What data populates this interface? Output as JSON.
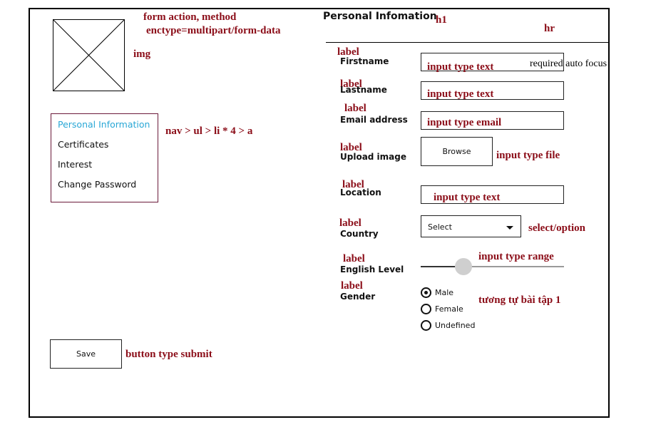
{
  "annotations": {
    "form_line1": "form action, method",
    "form_line2": "enctype=multipart/form-data",
    "img": "img",
    "nav": "nav > ul > li * 4 > a",
    "h1": "h1",
    "hr": "hr",
    "button": "button type submit",
    "required": "required auto focus",
    "label": "label",
    "input_text": "input type text",
    "input_email": "input type email",
    "input_file": "input type file",
    "select": "select/option",
    "range": "input type range",
    "radio": "tương tự bài tập 1"
  },
  "nav": {
    "items": [
      {
        "label": "Personal Information",
        "active": true
      },
      {
        "label": "Certificates",
        "active": false
      },
      {
        "label": "Interest",
        "active": false
      },
      {
        "label": "Change Password",
        "active": false
      }
    ]
  },
  "form": {
    "title": "Personal Infomation",
    "fields": {
      "firstname": "Firstname",
      "lastname": "Lastname",
      "email": "Email address",
      "upload": "Upload image",
      "location": "Location",
      "country": "Country",
      "english": "English Level",
      "gender": "Gender"
    },
    "browse_label": "Browse",
    "select_value": "Select",
    "range_value": 0.3,
    "gender_options": [
      "Male",
      "Female",
      "Undefined"
    ],
    "gender_selected": "Male",
    "save_label": "Save"
  },
  "colors": {
    "annotation": "#8b0d18",
    "nav_active": "#29a7d6",
    "nav_border": "#6b1a3a"
  }
}
